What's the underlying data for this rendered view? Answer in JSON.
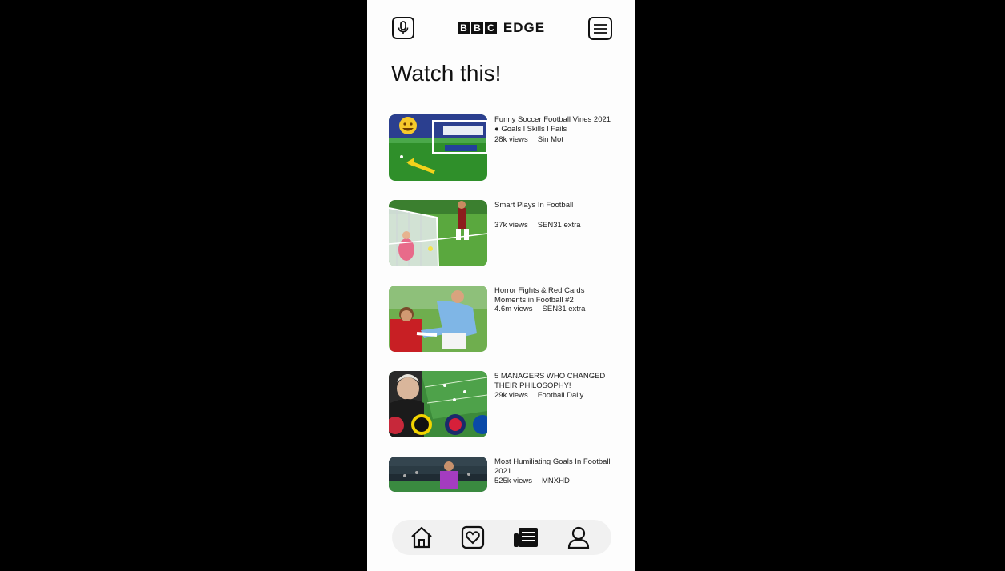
{
  "header": {
    "logo_blocks": [
      "B",
      "B",
      "C"
    ],
    "logo_text": "EDGE",
    "mic_icon": "microphone-icon",
    "menu_icon": "hamburger-menu-icon"
  },
  "page_title": "Watch this!",
  "videos": [
    {
      "title": "Funny Soccer Football Vines 2021 ● Goals l Skills l Fails",
      "views": "28k views",
      "channel": "Sin Mot",
      "thumbnail": "soccer-goal-laughing-emoji-thumbnail"
    },
    {
      "title": "Smart Plays In Football",
      "views": "37k views",
      "channel": "SEN31 extra",
      "thumbnail": "goalkeeper-save-thumbnail"
    },
    {
      "title": "Horror Fights & Red Cards Moments in Football #2",
      "views": "4.6m views",
      "channel": "SEN31 extra",
      "thumbnail": "tackle-thumbnail"
    },
    {
      "title": "5 MANAGERS WHO CHANGED THEIR PHILOSOPHY!",
      "views": "29k views",
      "channel": "Football Daily",
      "thumbnail": "managers-club-badges-thumbnail"
    },
    {
      "title": "Most Humiliating Goals In Football 2021",
      "views": "525k views",
      "channel": "MNXHD",
      "thumbnail": "stadium-player-thumbnail"
    }
  ],
  "bottom_nav": [
    {
      "icon": "home-icon"
    },
    {
      "icon": "heart-icon"
    },
    {
      "icon": "news-icon"
    },
    {
      "icon": "profile-icon"
    }
  ]
}
